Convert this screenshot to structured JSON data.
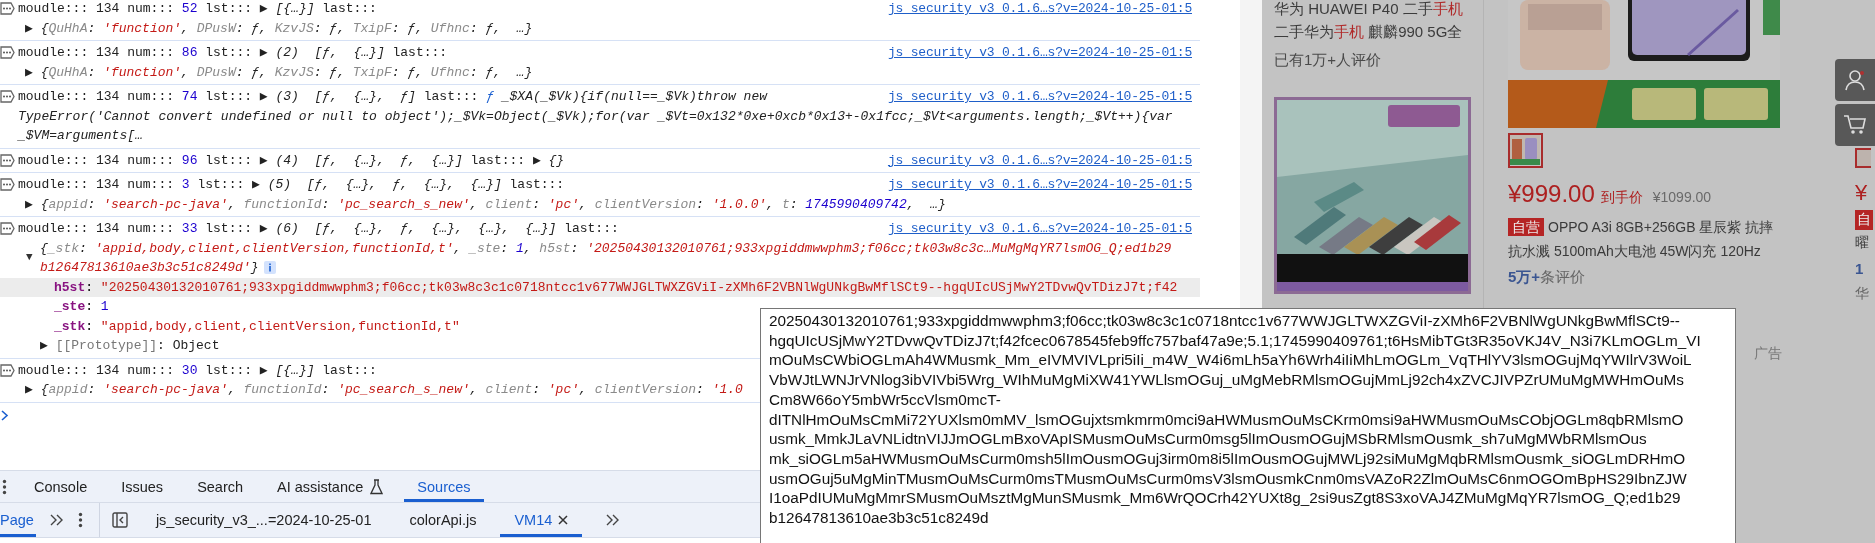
{
  "console": {
    "rows": [
      {
        "link": "js_security_v3_0.1.6…s?v=2024-10-25-01:5",
        "lines": [
          {
            "kind": "head",
            "segments": [
              {
                "kind": "plain",
                "text": "moudle::: 134 num::: "
              },
              {
                "kind": "number",
                "text": "52"
              },
              {
                "kind": "plain",
                "text": " lst::: ▶ "
              },
              {
                "kind": "italic",
                "text": "[{…}]"
              },
              {
                "kind": "plain",
                "text": " last:::"
              }
            ]
          },
          {
            "kind": "preview",
            "segments": [
              {
                "kind": "plain",
                "text": "▶ "
              },
              {
                "kind": "italic",
                "text": "{"
              },
              {
                "kind": "key",
                "text": "QuHhA"
              },
              {
                "kind": "italic",
                "text": ": "
              },
              {
                "kind": "string",
                "text": "'function'"
              },
              {
                "kind": "italic",
                "text": ", "
              },
              {
                "kind": "key",
                "text": "DPusW"
              },
              {
                "kind": "italic",
                "text": ": ƒ, "
              },
              {
                "kind": "key",
                "text": "KzvJS"
              },
              {
                "kind": "italic",
                "text": ": ƒ, "
              },
              {
                "kind": "key",
                "text": "TxipF"
              },
              {
                "kind": "italic",
                "text": ": ƒ, "
              },
              {
                "kind": "key",
                "text": "Ufhnc"
              },
              {
                "kind": "italic",
                "text": ": ƒ,  …}"
              }
            ]
          }
        ]
      },
      {
        "link": "js_security_v3_0.1.6…s?v=2024-10-25-01:5",
        "lines": [
          {
            "kind": "head",
            "segments": [
              {
                "kind": "plain",
                "text": "moudle::: 134 num::: "
              },
              {
                "kind": "number",
                "text": "86"
              },
              {
                "kind": "plain",
                "text": " lst::: ▶ "
              },
              {
                "kind": "italic",
                "text": "(2)  [ƒ,  {…}]"
              },
              {
                "kind": "plain",
                "text": " last:::"
              }
            ]
          },
          {
            "kind": "preview",
            "segments": [
              {
                "kind": "plain",
                "text": "▶ "
              },
              {
                "kind": "italic",
                "text": "{"
              },
              {
                "kind": "key",
                "text": "QuHhA"
              },
              {
                "kind": "italic",
                "text": ": "
              },
              {
                "kind": "string",
                "text": "'function'"
              },
              {
                "kind": "italic",
                "text": ", "
              },
              {
                "kind": "key",
                "text": "DPusW"
              },
              {
                "kind": "italic",
                "text": ": ƒ, "
              },
              {
                "kind": "key",
                "text": "KzvJS"
              },
              {
                "kind": "italic",
                "text": ": ƒ, "
              },
              {
                "kind": "key",
                "text": "TxipF"
              },
              {
                "kind": "italic",
                "text": ": ƒ, "
              },
              {
                "kind": "key",
                "text": "Ufhnc"
              },
              {
                "kind": "italic",
                "text": ": ƒ,  …}"
              }
            ]
          }
        ]
      },
      {
        "link": "js_security_v3_0.1.6…s?v=2024-10-25-01:5",
        "lines": [
          {
            "kind": "head",
            "segments": [
              {
                "kind": "plain",
                "text": "moudle::: 134 num::: "
              },
              {
                "kind": "number",
                "text": "74"
              },
              {
                "kind": "plain",
                "text": " lst::: ▶ "
              },
              {
                "kind": "italic",
                "text": "(3)  [ƒ,  {…},  ƒ]"
              },
              {
                "kind": "plain",
                "text": " last::: "
              },
              {
                "kind": "function",
                "text": "ƒ"
              },
              {
                "kind": "italic",
                "text": " _$XA(_$Vk){if(null==_$Vk)throw new"
              }
            ]
          },
          {
            "kind": "continuation",
            "segments": [
              {
                "kind": "italic",
                "text": "TypeError('Cannot convert undefined or null to object');_$Vk=Object(_$Vk);for(var _$Vt=0x132*0xe+0xcb*0x13+-0x1fcc;_$Vt<arguments.length;_$Vt++){var"
              }
            ]
          },
          {
            "kind": "continuation",
            "segments": [
              {
                "kind": "italic",
                "text": "_$VM=arguments[…"
              }
            ]
          }
        ]
      },
      {
        "link": "js_security_v3_0.1.6…s?v=2024-10-25-01:5",
        "lines": [
          {
            "kind": "head",
            "segments": [
              {
                "kind": "plain",
                "text": "moudle::: 134 num::: "
              },
              {
                "kind": "number",
                "text": "96"
              },
              {
                "kind": "plain",
                "text": " lst::: ▶ "
              },
              {
                "kind": "italic",
                "text": "(4)  [ƒ,  {…},  ƒ,  {…}]"
              },
              {
                "kind": "plain",
                "text": " last::: ▶ "
              },
              {
                "kind": "italic",
                "text": "{}"
              }
            ]
          }
        ]
      },
      {
        "link": "js_security_v3_0.1.6…s?v=2024-10-25-01:5",
        "lines": [
          {
            "kind": "head",
            "segments": [
              {
                "kind": "plain",
                "text": "moudle::: 134 num::: "
              },
              {
                "kind": "number",
                "text": "3"
              },
              {
                "kind": "plain",
                "text": " lst::: ▶ "
              },
              {
                "kind": "italic",
                "text": "(5)  [ƒ,  {…},  ƒ,  {…},  {…}]"
              },
              {
                "kind": "plain",
                "text": " last:::"
              }
            ]
          },
          {
            "kind": "preview",
            "segments": [
              {
                "kind": "plain",
                "text": "▶ "
              },
              {
                "kind": "italic",
                "text": "{"
              },
              {
                "kind": "key",
                "text": "appid"
              },
              {
                "kind": "italic",
                "text": ": "
              },
              {
                "kind": "string",
                "text": "'search-pc-java'"
              },
              {
                "kind": "italic",
                "text": ", "
              },
              {
                "kind": "key",
                "text": "functionId"
              },
              {
                "kind": "italic",
                "text": ": "
              },
              {
                "kind": "string",
                "text": "'pc_search_s_new'"
              },
              {
                "kind": "italic",
                "text": ", "
              },
              {
                "kind": "key",
                "text": "client"
              },
              {
                "kind": "italic",
                "text": ": "
              },
              {
                "kind": "string",
                "text": "'pc'"
              },
              {
                "kind": "italic",
                "text": ", "
              },
              {
                "kind": "key",
                "text": "clientVersion"
              },
              {
                "kind": "italic",
                "text": ": "
              },
              {
                "kind": "string",
                "text": "'1.0.0'"
              },
              {
                "kind": "italic",
                "text": ", "
              },
              {
                "kind": "key",
                "text": "t"
              },
              {
                "kind": "italic",
                "text": ": "
              },
              {
                "kind": "number",
                "text": "1745990409742"
              },
              {
                "kind": "italic",
                "text": ",  …}"
              }
            ]
          }
        ]
      },
      {
        "link": "js_security_v3_0.1.6…s?v=2024-10-25-01:5",
        "lines": [
          {
            "kind": "head",
            "segments": [
              {
                "kind": "plain",
                "text": "moudle::: 134 num::: "
              },
              {
                "kind": "number",
                "text": "33"
              },
              {
                "kind": "plain",
                "text": " lst::: ▶ "
              },
              {
                "kind": "italic",
                "text": "(6)  [ƒ,  {…},  ƒ,  {…},  {…},  {…}]"
              },
              {
                "kind": "plain",
                "text": " last:::"
              }
            ]
          },
          {
            "kind": "expanded",
            "toggle": "▼",
            "segments": [
              {
                "kind": "italic",
                "text": "{"
              },
              {
                "kind": "key",
                "text": "_stk"
              },
              {
                "kind": "italic",
                "text": ": "
              },
              {
                "kind": "string",
                "text": "'appid,body,client,clientVersion,functionId,t'"
              },
              {
                "kind": "italic",
                "text": ", "
              },
              {
                "kind": "key",
                "text": "_ste"
              },
              {
                "kind": "italic",
                "text": ": "
              },
              {
                "kind": "number",
                "text": "1"
              },
              {
                "kind": "italic",
                "text": ", "
              },
              {
                "kind": "key",
                "text": "h5st"
              },
              {
                "kind": "italic",
                "text": ": "
              },
              {
                "kind": "string",
                "text": "'20250430132010761;933xpgiddmwwphm3;f06cc;tk03w8c3c…MuMgMqYR7lsmOG_Q;ed1b29"
              }
            ],
            "wrap_segments": [
              {
                "kind": "string",
                "text": "b12647813610ae3b3c51c8249d'"
              },
              {
                "kind": "italic",
                "text": "}"
              }
            ]
          },
          {
            "kind": "property",
            "highlighted": true,
            "segments": [
              {
                "kind": "property",
                "text": "h5st"
              },
              {
                "kind": "plain",
                "text": ": "
              },
              {
                "kind": "string",
                "text": "\"20250430132010761;933xpgiddmwwphm3;f06cc;tk03w8c3c1c0718ntcc1v677WWJGLTWXZGViI-zXMh6F2VBNlWgUNkgBwMflSCt9--hgqUIcUSjMwY2TDvwQvTDizJ7t;f42"
              }
            ]
          },
          {
            "kind": "property",
            "highlighted": false,
            "segments": [
              {
                "kind": "property",
                "text": "_ste"
              },
              {
                "kind": "plain",
                "text": ": "
              },
              {
                "kind": "number",
                "text": "1"
              }
            ]
          },
          {
            "kind": "property",
            "highlighted": false,
            "segments": [
              {
                "kind": "property",
                "text": "_stk"
              },
              {
                "kind": "plain",
                "text": ": "
              },
              {
                "kind": "string",
                "text": "\"appid,body,client,clientVersion,functionId,t\""
              }
            ]
          },
          {
            "kind": "prototype",
            "segments": [
              {
                "kind": "plain",
                "text": "▶ "
              },
              {
                "kind": "dim",
                "text": "[[Prototype]]"
              },
              {
                "kind": "plain",
                "text": ": Object"
              }
            ]
          }
        ]
      },
      {
        "lines": [
          {
            "kind": "head",
            "segments": [
              {
                "kind": "plain",
                "text": "moudle::: 134 num::: "
              },
              {
                "kind": "number",
                "text": "30"
              },
              {
                "kind": "plain",
                "text": " lst::: ▶ "
              },
              {
                "kind": "italic",
                "text": "[{…}]"
              },
              {
                "kind": "plain",
                "text": " last:::"
              }
            ]
          },
          {
            "kind": "preview",
            "segments": [
              {
                "kind": "plain",
                "text": "▶ "
              },
              {
                "kind": "italic",
                "text": "{"
              },
              {
                "kind": "key",
                "text": "appid"
              },
              {
                "kind": "italic",
                "text": ": "
              },
              {
                "kind": "string",
                "text": "'search-pc-java'"
              },
              {
                "kind": "italic",
                "text": ", "
              },
              {
                "kind": "key",
                "text": "functionId"
              },
              {
                "kind": "italic",
                "text": ": "
              },
              {
                "kind": "string",
                "text": "'pc_search_s_new'"
              },
              {
                "kind": "italic",
                "text": ", "
              },
              {
                "kind": "key",
                "text": "client"
              },
              {
                "kind": "italic",
                "text": ": "
              },
              {
                "kind": "string",
                "text": "'pc'"
              },
              {
                "kind": "italic",
                "text": ", "
              },
              {
                "kind": "key",
                "text": "clientVersion"
              },
              {
                "kind": "italic",
                "text": ": "
              },
              {
                "kind": "string",
                "text": "'1.0"
              }
            ]
          }
        ]
      }
    ]
  },
  "drawer_tabs": [
    {
      "label": "Console",
      "selected": false,
      "kind": "plain"
    },
    {
      "label": "Issues",
      "selected": false,
      "kind": "plain"
    },
    {
      "label": "Search",
      "selected": false,
      "kind": "plain"
    },
    {
      "label": "AI assistance",
      "selected": false,
      "kind": "labs"
    },
    {
      "label": "Sources",
      "selected": true,
      "kind": "plain"
    }
  ],
  "navigator_tabs": [
    {
      "label": "Page",
      "selected": true
    }
  ],
  "editor_tabs": [
    {
      "label": "js_security_v3_...=2024-10-25-01",
      "selected": false,
      "closable": false
    },
    {
      "label": "colorApi.js",
      "selected": false,
      "closable": false
    },
    {
      "label": "VM14",
      "selected": true,
      "closable": true
    }
  ],
  "tooltip": {
    "lines": [
      "20250430132010761;933xpgiddmwwphm3;f06cc;tk03w8c3c1c0718ntcc1v677WWJGLTWXZGViI-zXMh6F2VBNlWgUNkgBwMflSCt9--",
      "hgqUIcUSjMwY2TDvwQvTDizJ7t;f42fcec0678545feb9ffc757baf47a9e;5.1;1745990409761;t6HsMibTGt3R35oVKJ4V_N3i7KLmOGLm_VI",
      "mOuMsCWbiOGLmAh4WMusmk_Mm_eIVMVIVLpri5iIi_m4W_W4i6mLh5aYh6Wrh4iIiMhLmOGLm_VqTHlYV3lsmOGujMqYWIlrV3WoiL",
      "VbWJtLWNJrVNlog3ibVIVbi5Wrg_WIhMuMgMiXW41YWLlsmOGuj_uMgMebRMlsmOGujMmLj92ch4xZVCJIVPZrUMuMgMWHmOuMs",
      "Cm8W66oY5mbWr5ccVlsm0mcT-",
      "dITNlHmOuMsCmMi72YUXlsm0mMV_lsmOGujxtsmkmrm0mci9aHWMusmOuMsCKrm0msi9aHWMusmOuMsCObjOGLm8qbRMlsmO",
      "usmk_MmkJLaVNLidtnVIJJmOGLmBxoVApISMusmOuMsCurm0msg5lImOusmOGujMSbRMlsmOusmk_sh7uMgMWbRMlsmOus",
      "mk_siOGLm5aHWMusmOuMsCurm0msh5lImOusmOGuj3irm0m8i5lImOusmOGujMWLj92siMuMgMqbRMlsmOusmk_siOGLmDRHmO",
      "usmOGuj5uMgMinTMusmOuMsCurm0msTMusmOuMsCurm0msV3lsmOusmkCnm0msVAZoR2ZlmOuMsC6nmOGOmBpHS29IbnZJW",
      "I1oaPdIUMuMgMmrSMusmOuMsztMgMunSMusmk_Mm6WrQOCrh42YUXt8g_2si9usZgt8S3xoVAJ4ZMuMgMqYR7lsmOG_Q;ed1b29",
      "b12647813610ae3b3c51c8249d"
    ]
  },
  "shop": {
    "left_product": {
      "title_lines": [
        [
          {
            "text": "华为 HUAWEI P40 二手",
            "highlight": false
          },
          {
            "text": "手机",
            "highlight": true
          }
        ],
        [
          {
            "text": "二手华为",
            "highlight": false
          },
          {
            "text": "手机",
            "highlight": true
          },
          {
            "text": " 麒麟990 5G全",
            "highlight": false
          }
        ]
      ],
      "reviews": "已有1万+人评价",
      "image": {
        "kind": "picture"
      }
    },
    "main_product": {
      "thumbnails": [
        {
          "selected": true
        }
      ],
      "price": "¥999.00",
      "price_note": "到手价",
      "old_price": "¥1099.00",
      "badge": "自营",
      "title_lines": [
        "OPPO A3i 8GB+256GB 星辰紫 抗摔",
        "抗水溅 5100mAh大电池 45W闪充 120Hz"
      ],
      "review_count": "5万+",
      "review_label": "条评价"
    },
    "edge_product": {
      "price": "¥",
      "badge": "自",
      "title": "曜",
      "review_count": "1",
      "shop": "华"
    },
    "ad_label": "广告"
  }
}
